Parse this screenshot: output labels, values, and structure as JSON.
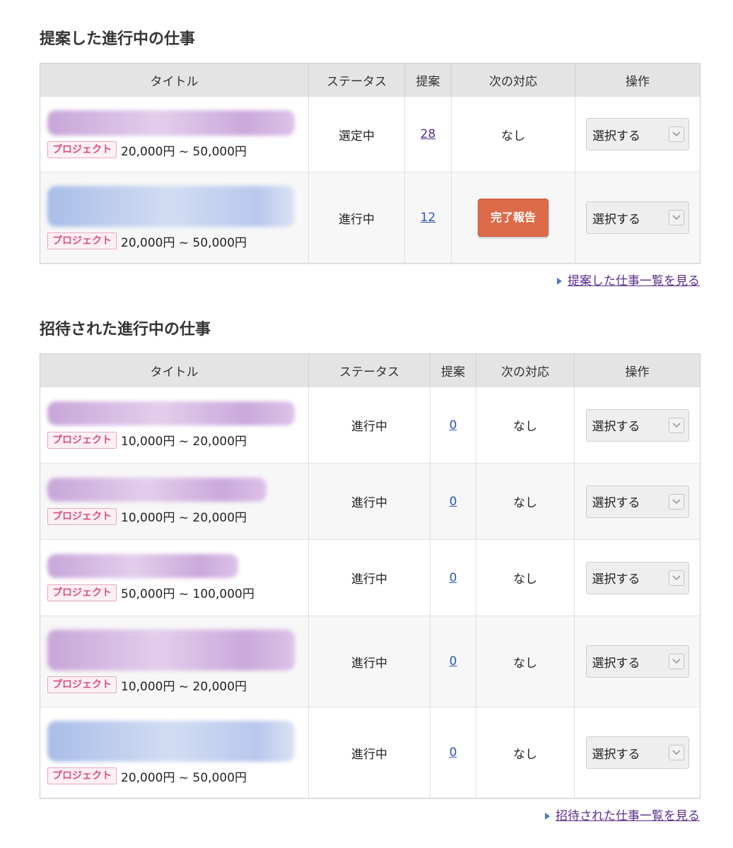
{
  "proposed": {
    "heading": "提案した進行中の仕事",
    "columns": {
      "title": "タイトル",
      "status": "ステータス",
      "proposals": "提案",
      "next_action": "次の対応",
      "operation": "操作"
    },
    "rows": [
      {
        "badge": "プロジェクト",
        "budget": "20,000円 ~ 50,000円",
        "status": "選定中",
        "proposals": "28",
        "next_action": "なし",
        "select": "選択する"
      },
      {
        "badge": "プロジェクト",
        "budget": "20,000円 ~ 50,000円",
        "status": "進行中",
        "proposals": "12",
        "next_action_button": "完了報告",
        "select": "選択する"
      }
    ],
    "more_link": "提案した仕事一覧を見る"
  },
  "invited": {
    "heading": "招待された進行中の仕事",
    "columns": {
      "title": "タイトル",
      "status": "ステータス",
      "proposals": "提案",
      "next_action": "次の対応",
      "operation": "操作"
    },
    "rows": [
      {
        "badge": "プロジェクト",
        "budget": "10,000円 ~ 20,000円",
        "status": "進行中",
        "proposals": "0",
        "next_action": "なし",
        "select": "選択する"
      },
      {
        "badge": "プロジェクト",
        "budget": "10,000円 ~ 20,000円",
        "status": "進行中",
        "proposals": "0",
        "next_action": "なし",
        "select": "選択する"
      },
      {
        "badge": "プロジェクト",
        "budget": "50,000円 ~ 100,000円",
        "status": "進行中",
        "proposals": "0",
        "next_action": "なし",
        "select": "選択する"
      },
      {
        "badge": "プロジェクト",
        "budget": "10,000円 ~ 20,000円",
        "status": "進行中",
        "proposals": "0",
        "next_action": "なし",
        "select": "選択する"
      },
      {
        "badge": "プロジェクト",
        "budget": "20,000円 ~ 50,000円",
        "status": "進行中",
        "proposals": "0",
        "next_action": "なし",
        "select": "選択する"
      }
    ],
    "more_link": "招待された仕事一覧を見る"
  },
  "colors": {
    "badge_text": "#d94f7c",
    "complete_button": "#dd6b4a",
    "link": "#2a57b8",
    "visited_link": "#5a2d8c"
  },
  "icons": {
    "select_arrow": "chevron-down-icon",
    "link_marker": "triangle-right-icon"
  }
}
